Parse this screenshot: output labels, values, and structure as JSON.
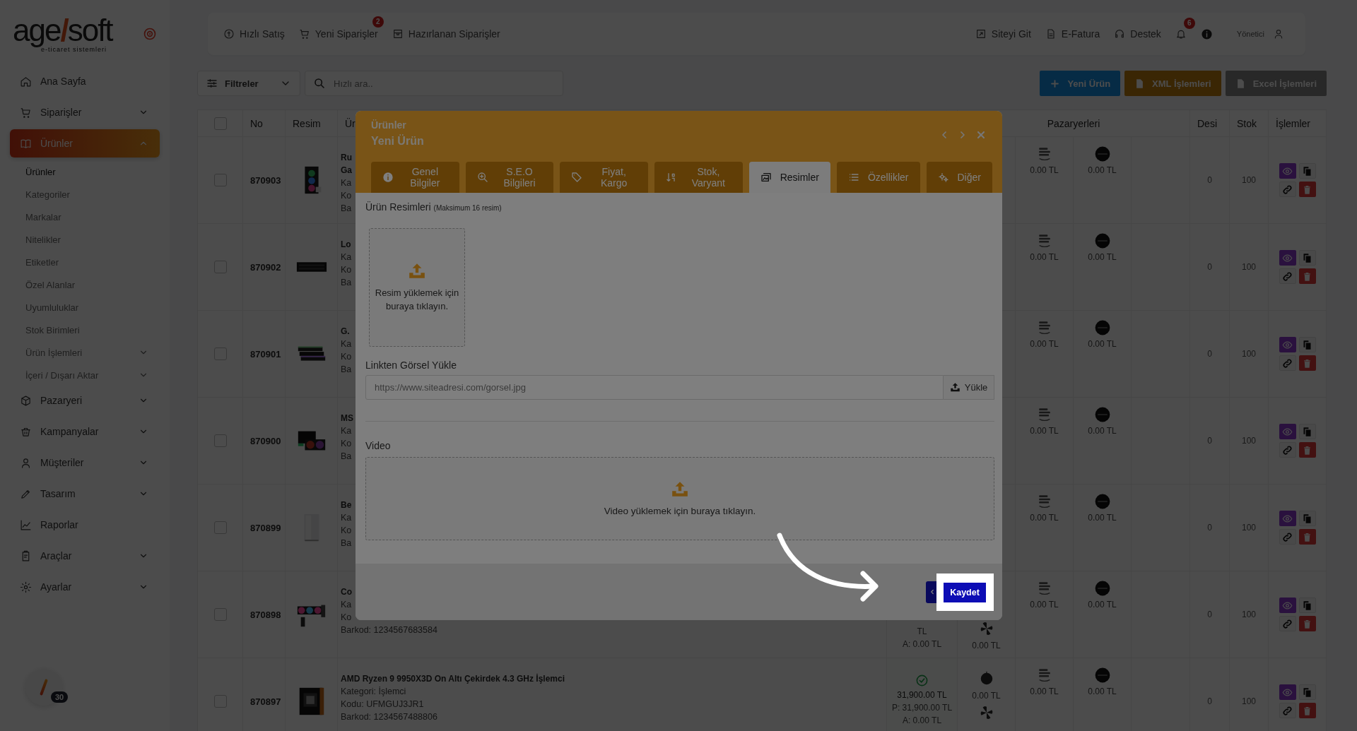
{
  "logo": {
    "left": "age",
    "mark": "/",
    "right": "soft",
    "tagline": "e-ticaret sistemleri"
  },
  "sidebar": {
    "items": [
      {
        "label": "Ana Sayfa",
        "kind": "link",
        "selected": false
      },
      {
        "label": "Siparişler",
        "kind": "group",
        "selected": false,
        "expanded": false
      },
      {
        "label": "Ürünler",
        "kind": "group",
        "selected": true,
        "expanded": true,
        "children": [
          {
            "label": "Ürünler",
            "kind": "link",
            "selected": true
          },
          {
            "label": "Kategoriler",
            "kind": "link",
            "selected": false
          },
          {
            "label": "Markalar",
            "kind": "link",
            "selected": false
          },
          {
            "label": "Nitelikler",
            "kind": "link",
            "selected": false
          },
          {
            "label": "Etiketler",
            "kind": "link",
            "selected": false
          },
          {
            "label": "Özel Alanlar",
            "kind": "link",
            "selected": false
          },
          {
            "label": "Uyumluluklar",
            "kind": "link",
            "selected": false
          },
          {
            "label": "Stok Birimleri",
            "kind": "link",
            "selected": false
          },
          {
            "label": "Ürün İşlemleri",
            "kind": "group",
            "selected": false,
            "expanded": false
          },
          {
            "label": "İçeri / Dışarı Aktar",
            "kind": "group",
            "selected": false,
            "expanded": false
          }
        ]
      },
      {
        "label": "Pazaryeri",
        "kind": "group",
        "selected": false,
        "expanded": false
      },
      {
        "label": "Kampanyalar",
        "kind": "group",
        "selected": false,
        "expanded": false
      },
      {
        "label": "Müşteriler",
        "kind": "group",
        "selected": false,
        "expanded": false
      },
      {
        "label": "Tasarım",
        "kind": "group",
        "selected": false,
        "expanded": false
      },
      {
        "label": "Raporlar",
        "kind": "link",
        "selected": false
      },
      {
        "label": "Araçlar",
        "kind": "group",
        "selected": false,
        "expanded": false
      },
      {
        "label": "Ayarlar",
        "kind": "group",
        "selected": false,
        "expanded": false
      }
    ],
    "avatar_badge": "30"
  },
  "topbar": {
    "left": [
      {
        "label": "Hızlı Satış"
      },
      {
        "label": "Yeni Siparişler",
        "badge": "2"
      },
      {
        "label": "Hazırlanan Siparişler"
      }
    ],
    "right": [
      {
        "label": "Siteyi Git"
      },
      {
        "label": "E-Fatura"
      },
      {
        "label": "Destek"
      }
    ],
    "notifications_badge": "6",
    "user": "Yönetici"
  },
  "toolbar": {
    "filter": "Filtreler",
    "search": {
      "placeholder": "Hızlı ara.."
    },
    "buttons": [
      {
        "label": "Yeni Ürün",
        "kind": "primary"
      },
      {
        "label": "XML İşlemleri",
        "kind": "warning"
      },
      {
        "label": "Excel İşlemleri",
        "kind": "muted"
      }
    ]
  },
  "table": {
    "select_all_checked": false,
    "columns": [
      {
        "label": "No"
      },
      {
        "label": "Resim"
      },
      {
        "label": "Ür"
      },
      {
        "label": "Pazaryerleri"
      },
      {
        "label": "Desi"
      },
      {
        "label": "Stok"
      },
      {
        "label": "İşlemler"
      }
    ],
    "rows": [
      {
        "checked": false,
        "no": "870903",
        "name": [
          "Ru",
          "Ga"
        ],
        "details": [
          "Ka",
          "Ko",
          "Ba"
        ],
        "markets": [
          {
            "price": "0.00 TL"
          },
          {
            "price": "0.00 TL"
          }
        ],
        "desi": "0",
        "stock": "100"
      },
      {
        "checked": false,
        "no": "870902",
        "name": [
          "Lo"
        ],
        "details": [
          "Ka",
          "Ko",
          "Ba"
        ],
        "markets": [
          {
            "price": "0.00 TL"
          },
          {
            "price": "0.00 TL"
          }
        ],
        "desi": "0",
        "stock": "100"
      },
      {
        "checked": false,
        "no": "870901",
        "name": [
          "G."
        ],
        "details": [
          "Ka",
          "Ko",
          "Ba"
        ],
        "markets": [
          {
            "price": "0.00 TL"
          },
          {
            "price": "0.00 TL"
          }
        ],
        "desi": "0",
        "stock": "100"
      },
      {
        "checked": false,
        "no": "870900",
        "name": [
          "MS"
        ],
        "details": [
          "Ka",
          "Ko",
          "Ba"
        ],
        "markets": [
          {
            "price": "0.00 TL"
          },
          {
            "price": "0.00 TL"
          }
        ],
        "desi": "0",
        "stock": "100"
      },
      {
        "checked": false,
        "no": "870899",
        "name": [
          "Be"
        ],
        "details": [
          "Ka",
          "Ko",
          "Ba"
        ],
        "markets": [
          {
            "price": "0.00 TL"
          },
          {
            "price": "0.00 TL"
          }
        ],
        "desi": "0",
        "stock": "100"
      },
      {
        "checked": false,
        "no": "870898",
        "name": [
          "Co"
        ],
        "details": [
          "Ka",
          "Ko",
          "Barkod: 1234567683584"
        ],
        "price": {
          "approved": false,
          "lines": [
            "TL",
            "A: 0.00 TL"
          ]
        },
        "extra": [
          {
            "kind": "fan",
            "price": "0.00 TL"
          }
        ],
        "markets": [
          {
            "price": "0.00 TL"
          },
          {
            "price": "0.00 TL"
          }
        ],
        "desi": "0",
        "stock": "100"
      },
      {
        "checked": false,
        "no": "870897",
        "name": [
          "AMD Ryzen 9 9950X3D On Altı Çekirdek 4.3 GHz İşlemci"
        ],
        "details": [
          "Kategori: İşlemci",
          "Kodu: UFMGUJ3JR1",
          "Barkod: 1234567488806"
        ],
        "price": {
          "approved": true,
          "lines": [
            "31,900.00 TL",
            "P: 31,900.00 TL",
            "A: 0.00 TL"
          ]
        },
        "extra": [
          {
            "kind": "ball",
            "price": "0.00 TL"
          },
          {
            "kind": "fan"
          }
        ],
        "markets": [
          {
            "price": "0.00 TL"
          },
          {
            "price": "0.00 TL"
          }
        ],
        "desi": "0",
        "stock": "100"
      }
    ]
  },
  "modal": {
    "section": "Ürünler",
    "title": "Yeni Ürün",
    "tabs": [
      {
        "label": "Genel Bilgiler",
        "selected": false
      },
      {
        "label": "S.E.O Bilgileri",
        "selected": false
      },
      {
        "label": "Fiyat, Kargo",
        "selected": false
      },
      {
        "label": "Stok, Varyant",
        "selected": false
      },
      {
        "label": "Resimler",
        "selected": true
      },
      {
        "label": "Özellikler",
        "selected": false
      },
      {
        "label": "Diğer",
        "selected": false
      }
    ],
    "images": {
      "label": "Ürün Resimleri",
      "hint": "(Maksimum 16 resim)",
      "dropzone": "Resim yüklemek için buraya tıklayın."
    },
    "link": {
      "label": "Linkten Görsel Yükle",
      "placeholder": "https://www.siteadresi.com/gorsel.jpg",
      "button": "Yükle"
    },
    "video": {
      "label": "Video",
      "dropzone": "Video yüklemek için buraya tıklayın."
    },
    "save": {
      "label": "Kaydet",
      "highlighted": true
    }
  }
}
